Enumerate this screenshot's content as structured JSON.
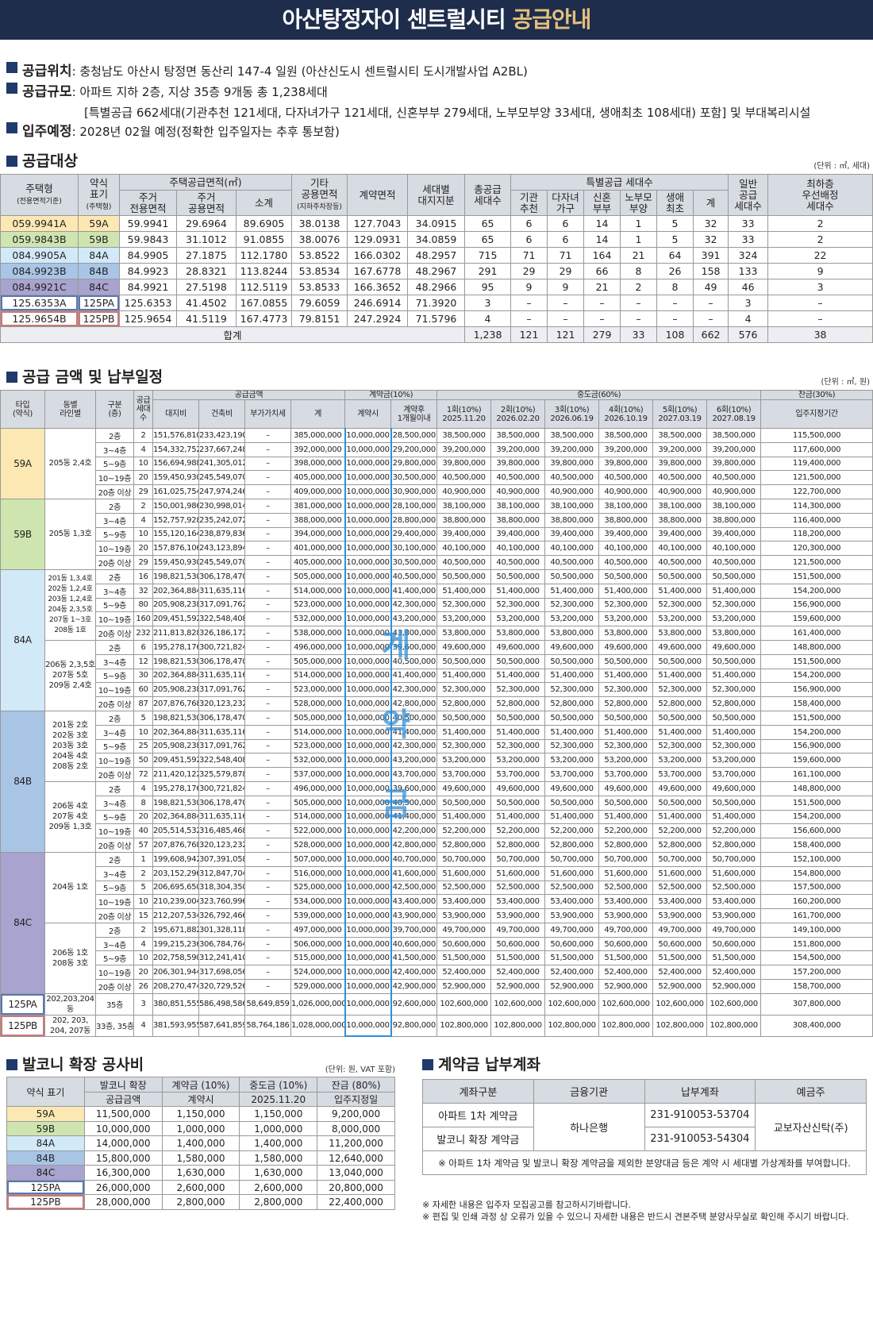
{
  "title": {
    "main": "아산탕정자이 센트럴시티 ",
    "accent": "공급안내"
  },
  "info": [
    {
      "key": "공급위치",
      "text": " : 충청남도 아산시 탕정면 동산리 147-4 일원 (아산신도시 센트럴시티 도시개발사업 A2BL)"
    },
    {
      "key": "공급규모",
      "text": " : 아파트 지하 2층, 지상 35층 9개동 총 1,238세대",
      "text2": "[특별공급 662세대(기관추천 121세대, 다자녀가구 121세대, 신혼부부 279세대, 노부모부양 33세대, 생애최초 108세대) 포함] 및 부대복리시설"
    },
    {
      "key": "입주예정",
      "text": " : 2028년 02월 예정(정확한 입주일자는 추후 통보함)"
    }
  ],
  "supply": {
    "title": "공급대상",
    "unit": "(단위 : ㎡, 세대)",
    "headers": [
      "주택형",
      "(전용면적기준)",
      "약식",
      "표기",
      "(주택형)",
      "주택공급면적(㎡)",
      "주거",
      "전용면적",
      "주거",
      "공용면적",
      "소계",
      "기타",
      "공용면적",
      "(지하주차장등)",
      "계약면적",
      "세대별",
      "대지지분",
      "총공급",
      "세대수",
      "특별공급 세대수",
      "기관",
      "추천",
      "다자녀",
      "가구",
      "신혼",
      "부부",
      "노부모",
      "부양",
      "생애",
      "최초",
      "계",
      "일반",
      "공급",
      "세대수",
      "최하층",
      "우선배정",
      "세대수"
    ],
    "rows": [
      [
        "059.9941A",
        "59A",
        "59.9941",
        "29.6964",
        "89.6905",
        "38.0138",
        "127.7043",
        "34.0915",
        "65",
        "6",
        "6",
        "14",
        "1",
        "5",
        "32",
        "33",
        "2"
      ],
      [
        "059.9843B",
        "59B",
        "59.9843",
        "31.1012",
        "91.0855",
        "38.0076",
        "129.0931",
        "34.0859",
        "65",
        "6",
        "6",
        "14",
        "1",
        "5",
        "32",
        "33",
        "2"
      ],
      [
        "084.9905A",
        "84A",
        "84.9905",
        "27.1875",
        "112.1780",
        "53.8522",
        "166.0302",
        "48.2957",
        "715",
        "71",
        "71",
        "164",
        "21",
        "64",
        "391",
        "324",
        "22"
      ],
      [
        "084.9923B",
        "84B",
        "84.9923",
        "28.8321",
        "113.8244",
        "53.8534",
        "167.6778",
        "48.2967",
        "291",
        "29",
        "29",
        "66",
        "8",
        "26",
        "158",
        "133",
        "9"
      ],
      [
        "084.9921C",
        "84C",
        "84.9921",
        "27.5198",
        "112.5119",
        "53.8533",
        "166.3652",
        "48.2966",
        "95",
        "9",
        "9",
        "21",
        "2",
        "8",
        "49",
        "46",
        "3"
      ],
      [
        "125.6353A",
        "125PA",
        "125.6353",
        "41.4502",
        "167.0855",
        "79.6059",
        "246.6914",
        "71.3920",
        "3",
        "–",
        "–",
        "–",
        "–",
        "–",
        "–",
        "3",
        "–"
      ],
      [
        "125.9654B",
        "125PB",
        "125.9654",
        "41.5119",
        "167.4773",
        "79.8151",
        "247.2924",
        "71.5796",
        "4",
        "–",
        "–",
        "–",
        "–",
        "–",
        "–",
        "4",
        "–"
      ]
    ],
    "total": [
      "합계",
      "1,238",
      "121",
      "121",
      "279",
      "33",
      "108",
      "662",
      "576",
      "38"
    ]
  },
  "price": {
    "title": "공급 금액 및 납부일정",
    "unit": "(단위 : ㎡, 원)",
    "headers": [
      "타입",
      "(약식)",
      "동별",
      "라인별",
      "구분",
      "(층)",
      "공급",
      "세대",
      "수",
      "공급금액",
      "대지비",
      "건축비",
      "부가가치세",
      "계",
      "계약금(10%)",
      "계약시",
      "계약후",
      "1개월이내",
      "중도금(60%)",
      "1회(10%)",
      "2025.11.20",
      "2회(10%)",
      "2026.02.20",
      "3회(10%)",
      "2026.06.19",
      "4회(10%)",
      "2026.10.19",
      "5회(10%)",
      "2027.03.19",
      "6회(10%)",
      "2027.08.19",
      "잔금(30%)",
      "입주지정기간"
    ],
    "types": [
      "59A",
      "59B",
      "84A",
      "84B",
      "84C",
      "125PA",
      "125PB"
    ],
    "dongs": [
      "205동 2,4호",
      "205동 1,3호",
      "201동 1,3,4호\n202동 1,2,4호\n203동 1,2,4호\n204동 2,3,5호\n207동 1~3호\n208동 1호",
      "206동 2,3,5호\n207동 5호\n209동 2,4호",
      "201동 2호\n202동 3호\n203동 3호\n204동 4호\n208동 2호",
      "206동 4호\n207동 4호\n209동 1,3호",
      "204동 1호",
      "206동 1호\n208동 3호",
      "202,203,204동",
      "202, 203,\n204, 207동"
    ],
    "stamp": "계약금",
    "rows": [
      [
        "2층",
        "2",
        "151,576,810",
        "233,423,190",
        "–",
        "385,000,000",
        "10,000,000",
        "28,500,000",
        "38,500,000",
        "115,500,000"
      ],
      [
        "3~4층",
        "4",
        "154,332,752",
        "237,667,248",
        "–",
        "392,000,000",
        "10,000,000",
        "29,200,000",
        "39,200,000",
        "117,600,000"
      ],
      [
        "5~9층",
        "10",
        "156,694,988",
        "241,305,012",
        "–",
        "398,000,000",
        "10,000,000",
        "29,800,000",
        "39,800,000",
        "119,400,000"
      ],
      [
        "10~19층",
        "20",
        "159,450,930",
        "245,549,070",
        "–",
        "405,000,000",
        "10,000,000",
        "30,500,000",
        "40,500,000",
        "121,500,000"
      ],
      [
        "20층 이상",
        "29",
        "161,025,754",
        "247,974,246",
        "–",
        "409,000,000",
        "10,000,000",
        "30,900,000",
        "40,900,000",
        "122,700,000"
      ],
      [
        "2층",
        "2",
        "150,001,986",
        "230,998,014",
        "–",
        "381,000,000",
        "10,000,000",
        "28,100,000",
        "38,100,000",
        "114,300,000"
      ],
      [
        "3~4층",
        "4",
        "152,757,928",
        "235,242,072",
        "–",
        "388,000,000",
        "10,000,000",
        "28,800,000",
        "38,800,000",
        "116,400,000"
      ],
      [
        "5~9층",
        "10",
        "155,120,164",
        "238,879,836",
        "–",
        "394,000,000",
        "10,000,000",
        "29,400,000",
        "39,400,000",
        "118,200,000"
      ],
      [
        "10~19층",
        "20",
        "157,876,106",
        "243,123,894",
        "–",
        "401,000,000",
        "10,000,000",
        "30,100,000",
        "40,100,000",
        "120,300,000"
      ],
      [
        "20층 이상",
        "29",
        "159,450,930",
        "245,549,070",
        "–",
        "405,000,000",
        "10,000,000",
        "30,500,000",
        "40,500,000",
        "121,500,000"
      ],
      [
        "2층",
        "16",
        "198,821,530",
        "306,178,470",
        "–",
        "505,000,000",
        "10,000,000",
        "40,500,000",
        "50,500,000",
        "151,500,000"
      ],
      [
        "3~4층",
        "32",
        "202,364,884",
        "311,635,116",
        "–",
        "514,000,000",
        "10,000,000",
        "41,400,000",
        "51,400,000",
        "154,200,000"
      ],
      [
        "5~9층",
        "80",
        "205,908,238",
        "317,091,762",
        "–",
        "523,000,000",
        "10,000,000",
        "42,300,000",
        "52,300,000",
        "156,900,000"
      ],
      [
        "10~19층",
        "160",
        "209,451,592",
        "322,548,408",
        "–",
        "532,000,000",
        "10,000,000",
        "43,200,000",
        "53,200,000",
        "159,600,000"
      ],
      [
        "20층 이상",
        "232",
        "211,813,828",
        "326,186,172",
        "–",
        "538,000,000",
        "10,000,000",
        "43,800,000",
        "53,800,000",
        "161,400,000"
      ],
      [
        "2층",
        "6",
        "195,278,176",
        "300,721,824",
        "–",
        "496,000,000",
        "10,000,000",
        "39,600,000",
        "49,600,000",
        "148,800,000"
      ],
      [
        "3~4층",
        "12",
        "198,821,530",
        "306,178,470",
        "–",
        "505,000,000",
        "10,000,000",
        "40,500,000",
        "50,500,000",
        "151,500,000"
      ],
      [
        "5~9층",
        "30",
        "202,364,884",
        "311,635,116",
        "–",
        "514,000,000",
        "10,000,000",
        "41,400,000",
        "51,400,000",
        "154,200,000"
      ],
      [
        "10~19층",
        "60",
        "205,908,238",
        "317,091,762",
        "–",
        "523,000,000",
        "10,000,000",
        "42,300,000",
        "52,300,000",
        "156,900,000"
      ],
      [
        "20층 이상",
        "87",
        "207,876,768",
        "320,123,232",
        "–",
        "528,000,000",
        "10,000,000",
        "42,800,000",
        "52,800,000",
        "158,400,000"
      ],
      [
        "2층",
        "5",
        "198,821,530",
        "306,178,470",
        "–",
        "505,000,000",
        "10,000,000",
        "40,500,000",
        "50,500,000",
        "151,500,000"
      ],
      [
        "3~4층",
        "10",
        "202,364,884",
        "311,635,116",
        "–",
        "514,000,000",
        "10,000,000",
        "41,400,000",
        "51,400,000",
        "154,200,000"
      ],
      [
        "5~9층",
        "25",
        "205,908,238",
        "317,091,762",
        "–",
        "523,000,000",
        "10,000,000",
        "42,300,000",
        "52,300,000",
        "156,900,000"
      ],
      [
        "10~19층",
        "50",
        "209,451,592",
        "322,548,408",
        "–",
        "532,000,000",
        "10,000,000",
        "43,200,000",
        "53,200,000",
        "159,600,000"
      ],
      [
        "20층 이상",
        "72",
        "211,420,122",
        "325,579,878",
        "–",
        "537,000,000",
        "10,000,000",
        "43,700,000",
        "53,700,000",
        "161,100,000"
      ],
      [
        "2층",
        "4",
        "195,278,176",
        "300,721,824",
        "–",
        "496,000,000",
        "10,000,000",
        "39,600,000",
        "49,600,000",
        "148,800,000"
      ],
      [
        "3~4층",
        "8",
        "198,821,530",
        "306,178,470",
        "–",
        "505,000,000",
        "10,000,000",
        "40,500,000",
        "50,500,000",
        "151,500,000"
      ],
      [
        "5~9층",
        "20",
        "202,364,884",
        "311,635,116",
        "–",
        "514,000,000",
        "10,000,000",
        "41,400,000",
        "51,400,000",
        "154,200,000"
      ],
      [
        "10~19층",
        "40",
        "205,514,532",
        "316,485,468",
        "–",
        "522,000,000",
        "10,000,000",
        "42,200,000",
        "52,200,000",
        "156,600,000"
      ],
      [
        "20층 이상",
        "57",
        "207,876,768",
        "320,123,232",
        "–",
        "528,000,000",
        "10,000,000",
        "42,800,000",
        "52,800,000",
        "158,400,000"
      ],
      [
        "2층",
        "1",
        "199,608,942",
        "307,391,058",
        "–",
        "507,000,000",
        "10,000,000",
        "40,700,000",
        "50,700,000",
        "152,100,000"
      ],
      [
        "3~4층",
        "2",
        "203,152,296",
        "312,847,704",
        "–",
        "516,000,000",
        "10,000,000",
        "41,600,000",
        "51,600,000",
        "154,800,000"
      ],
      [
        "5~9층",
        "5",
        "206,695,650",
        "318,304,350",
        "–",
        "525,000,000",
        "10,000,000",
        "42,500,000",
        "52,500,000",
        "157,500,000"
      ],
      [
        "10~19층",
        "10",
        "210,239,004",
        "323,760,996",
        "–",
        "534,000,000",
        "10,000,000",
        "43,400,000",
        "53,400,000",
        "160,200,000"
      ],
      [
        "20층 이상",
        "15",
        "212,207,534",
        "326,792,466",
        "–",
        "539,000,000",
        "10,000,000",
        "43,900,000",
        "53,900,000",
        "161,700,000"
      ],
      [
        "2층",
        "2",
        "195,671,882",
        "301,328,118",
        "–",
        "497,000,000",
        "10,000,000",
        "39,700,000",
        "49,700,000",
        "149,100,000"
      ],
      [
        "3~4층",
        "4",
        "199,215,236",
        "306,784,764",
        "–",
        "506,000,000",
        "10,000,000",
        "40,600,000",
        "50,600,000",
        "151,800,000"
      ],
      [
        "5~9층",
        "10",
        "202,758,590",
        "312,241,410",
        "–",
        "515,000,000",
        "10,000,000",
        "41,500,000",
        "51,500,000",
        "154,500,000"
      ],
      [
        "10~19층",
        "20",
        "206,301,944",
        "317,698,056",
        "–",
        "524,000,000",
        "10,000,000",
        "42,400,000",
        "52,400,000",
        "157,200,000"
      ],
      [
        "20층 이상",
        "26",
        "208,270,474",
        "320,729,526",
        "–",
        "529,000,000",
        "10,000,000",
        "42,900,000",
        "52,900,000",
        "158,700,000"
      ],
      [
        "35층",
        "3",
        "380,851,555",
        "586,498,586",
        "58,649,859",
        "1,026,000,000",
        "10,000,000",
        "92,600,000",
        "102,600,000",
        "307,800,000"
      ],
      [
        "33층, 35층",
        "4",
        "381,593,955",
        "587,641,859",
        "58,764,186",
        "1,028,000,000",
        "10,000,000",
        "92,800,000",
        "102,800,000",
        "308,400,000"
      ]
    ]
  },
  "balcony": {
    "title": "발코니 확장 공사비",
    "unit": "(단위: 원, VAT 포함)",
    "headers": [
      "약식 표기",
      "발코니 확장",
      "공급금액",
      "계약금 (10%)",
      "계약시",
      "중도금 (10%)",
      "2025.11.20",
      "잔금 (80%)",
      "입주지정일"
    ],
    "rows": [
      [
        "59A",
        "11,500,000",
        "1,150,000",
        "1,150,000",
        "9,200,000"
      ],
      [
        "59B",
        "10,000,000",
        "1,000,000",
        "1,000,000",
        "8,000,000"
      ],
      [
        "84A",
        "14,000,000",
        "1,400,000",
        "1,400,000",
        "11,200,000"
      ],
      [
        "84B",
        "15,800,000",
        "1,580,000",
        "1,580,000",
        "12,640,000"
      ],
      [
        "84C",
        "16,300,000",
        "1,630,000",
        "1,630,000",
        "13,040,000"
      ],
      [
        "125PA",
        "26,000,000",
        "2,600,000",
        "2,600,000",
        "20,800,000"
      ],
      [
        "125PB",
        "28,000,000",
        "2,800,000",
        "2,800,000",
        "22,400,000"
      ]
    ]
  },
  "account": {
    "title": "계약금 납부계좌",
    "headers": [
      "계좌구분",
      "금융기관",
      "납부계좌",
      "예금주"
    ],
    "rows": [
      [
        "아파트 1차 계약금",
        "231-910053-53704"
      ],
      [
        "발코니 확장 계약금",
        "231-910053-54304"
      ]
    ],
    "bank": "하나은행",
    "holder": "교보자산신탁(주)",
    "note": "※ 아파트 1차 계약금 및 발코니 확장 계약금을 제외한 분양대금 등은 계약 시 세대별 가상계좌를 부여합니다."
  },
  "footnotes": [
    "※ 자세한 내용은 입주자 모집공고를 참고하시기바랍니다.",
    "※ 편집 및 인쇄 과정 상 오류가 있을 수 있으니 자세한 내용은 반드시 견본주택 분양사무실로 확인해 주시기 바랍니다."
  ],
  "colors": {
    "header_bg": "#1e2d4b",
    "accent": "#e3c07d",
    "c59A": "#fce8b3",
    "c59B": "#cfe5b0",
    "c84A": "#d2e9f8",
    "c84B": "#a9c5e6",
    "c84C": "#a9a3cf",
    "stamp": "#2f8fd8"
  }
}
